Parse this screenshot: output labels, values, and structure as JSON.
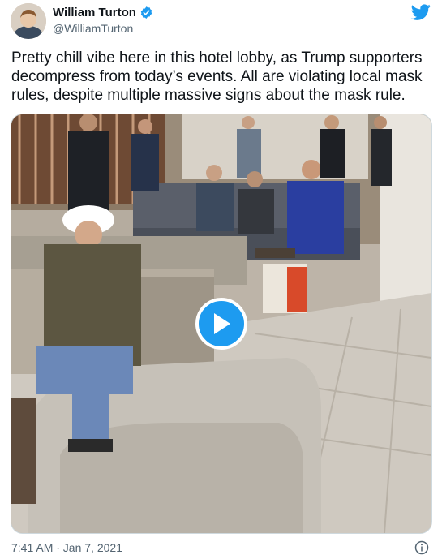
{
  "author": {
    "name": "William Turton",
    "handle": "@WilliamTurton",
    "verified": true
  },
  "tweet": {
    "text": "Pretty chill vibe here in this hotel lobby, as Trump supporters decompress from today’s events. All are violating local mask rules, despite multiple massive signs about the mask rule.",
    "timestamp": "7:41 AM · Jan 7, 2021"
  },
  "media": {
    "type": "video",
    "play_icon": "play-icon"
  },
  "icons": {
    "brand": "twitter-bird-icon",
    "verified": "verified-badge-icon",
    "info": "info-icon"
  },
  "colors": {
    "accent": "#1d9bf0",
    "text": "#0f1419",
    "secondary": "#536471",
    "border": "#cfd9de"
  }
}
